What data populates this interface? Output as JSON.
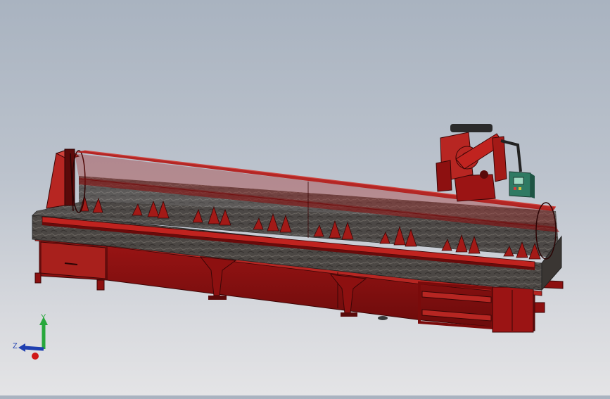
{
  "viewport": {
    "model_color": "#a01515",
    "model_color_dark": "#5e0b0b",
    "model_color_light": "#c83a32",
    "bed_color": "#4a4643",
    "hmi_color": "#2f7a63"
  },
  "triad": {
    "x_color": "#d01818",
    "y_color": "#28a83c",
    "z_color": "#1f3fb0",
    "y_label": "Y",
    "z_label": "Z"
  }
}
